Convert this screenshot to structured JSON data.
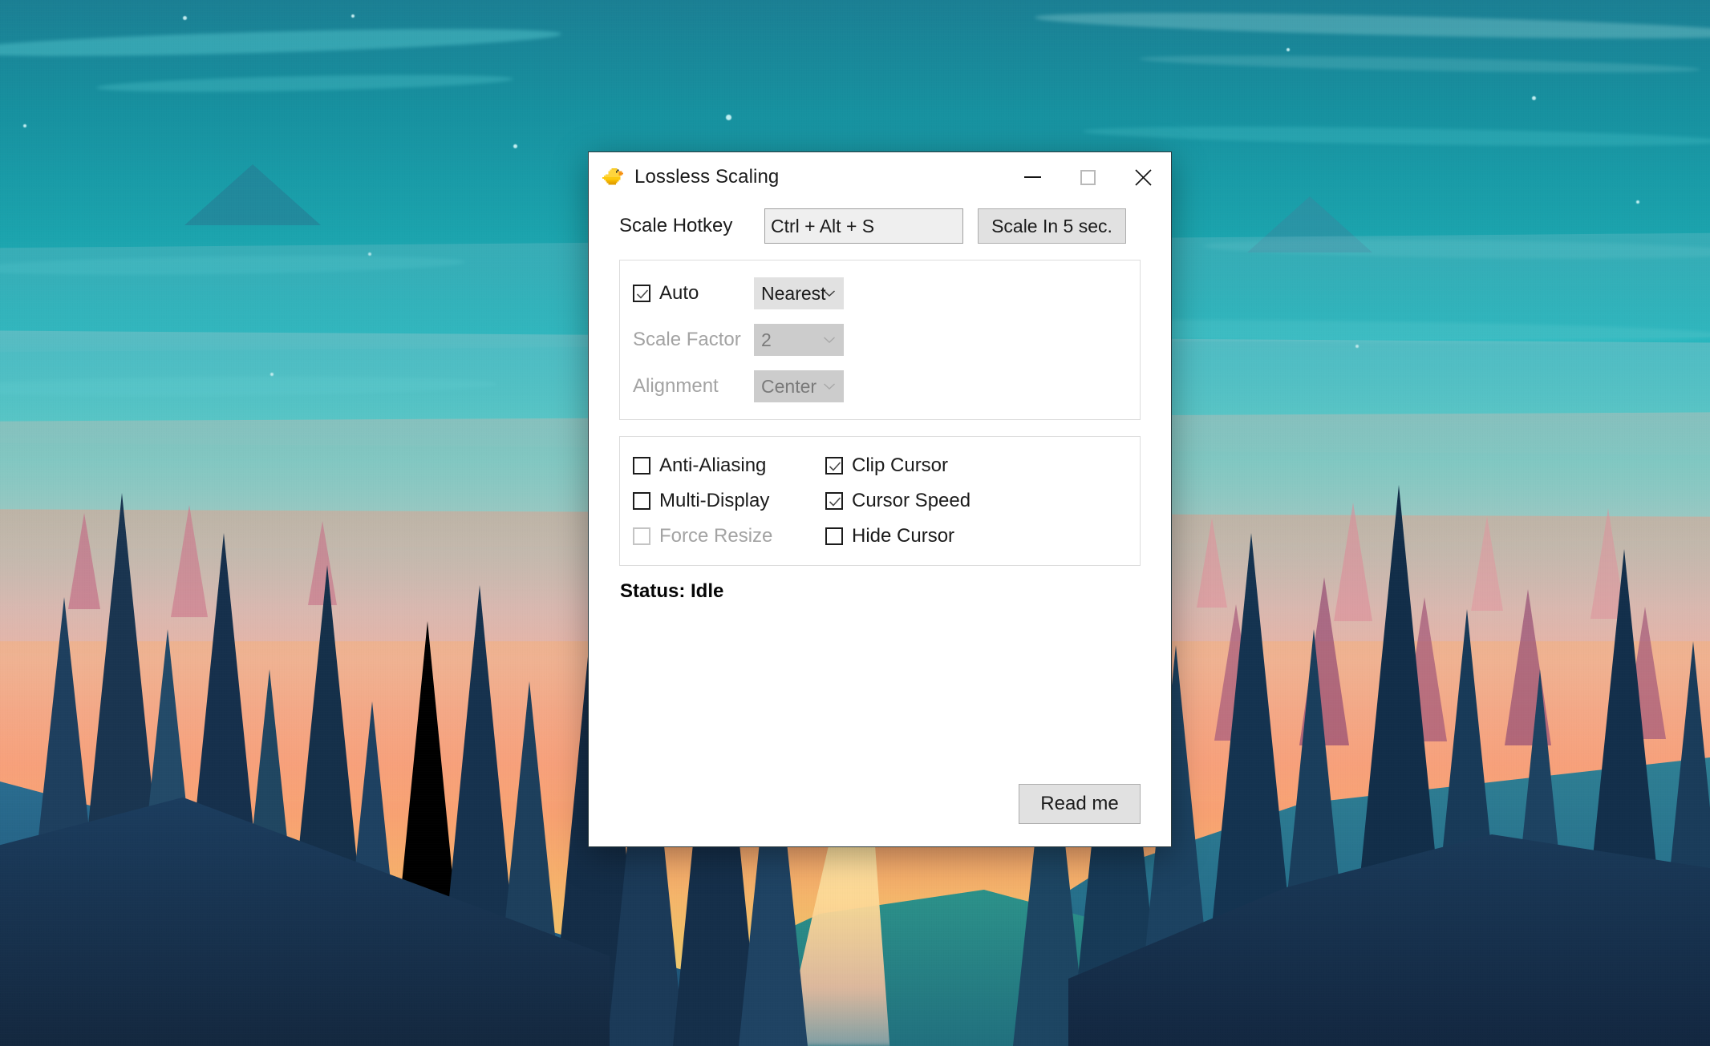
{
  "window": {
    "title": "Lossless Scaling",
    "icon": "duck-icon",
    "minimize_label": "Minimize",
    "maximize_label": "Maximize",
    "close_label": "Close"
  },
  "hotkey": {
    "label": "Scale Hotkey",
    "value": "Ctrl + Alt + S",
    "placeholder": "Ctrl + Alt + S",
    "scale_button": "Scale In 5 sec."
  },
  "scaling_group": {
    "auto": {
      "label": "Auto",
      "checked": true,
      "enabled": true
    },
    "mode": {
      "value": "Nearest",
      "enabled": true
    },
    "scale_factor": {
      "label": "Scale Factor",
      "value": "2",
      "enabled": false
    },
    "alignment": {
      "label": "Alignment",
      "value": "Center",
      "enabled": false
    }
  },
  "options_group": {
    "left": [
      {
        "label": "Anti-Aliasing",
        "checked": false,
        "enabled": true
      },
      {
        "label": "Multi-Display",
        "checked": false,
        "enabled": true
      },
      {
        "label": "Force Resize",
        "checked": false,
        "enabled": false
      }
    ],
    "right": [
      {
        "label": "Clip Cursor",
        "checked": true,
        "enabled": true
      },
      {
        "label": "Cursor Speed",
        "checked": true,
        "enabled": true
      },
      {
        "label": "Hide Cursor",
        "checked": false,
        "enabled": true
      }
    ]
  },
  "status": {
    "text": "Status: Idle"
  },
  "footer": {
    "readme_label": "Read me"
  },
  "colors": {
    "window_bg": "#ffffff",
    "control_bg": "#e1e1e1",
    "control_disabled_bg": "#cccccc",
    "text": "#1b1b1b",
    "text_disabled": "#a3a3a3",
    "group_border": "#dcdcdc",
    "window_border": "#2a3a3e",
    "wallpaper_sky_top": "#1b7f94",
    "wallpaper_sky_mid": "#2bb9c0",
    "wallpaper_sunset": "#f79d7d",
    "wallpaper_glow": "#e2d97e"
  }
}
